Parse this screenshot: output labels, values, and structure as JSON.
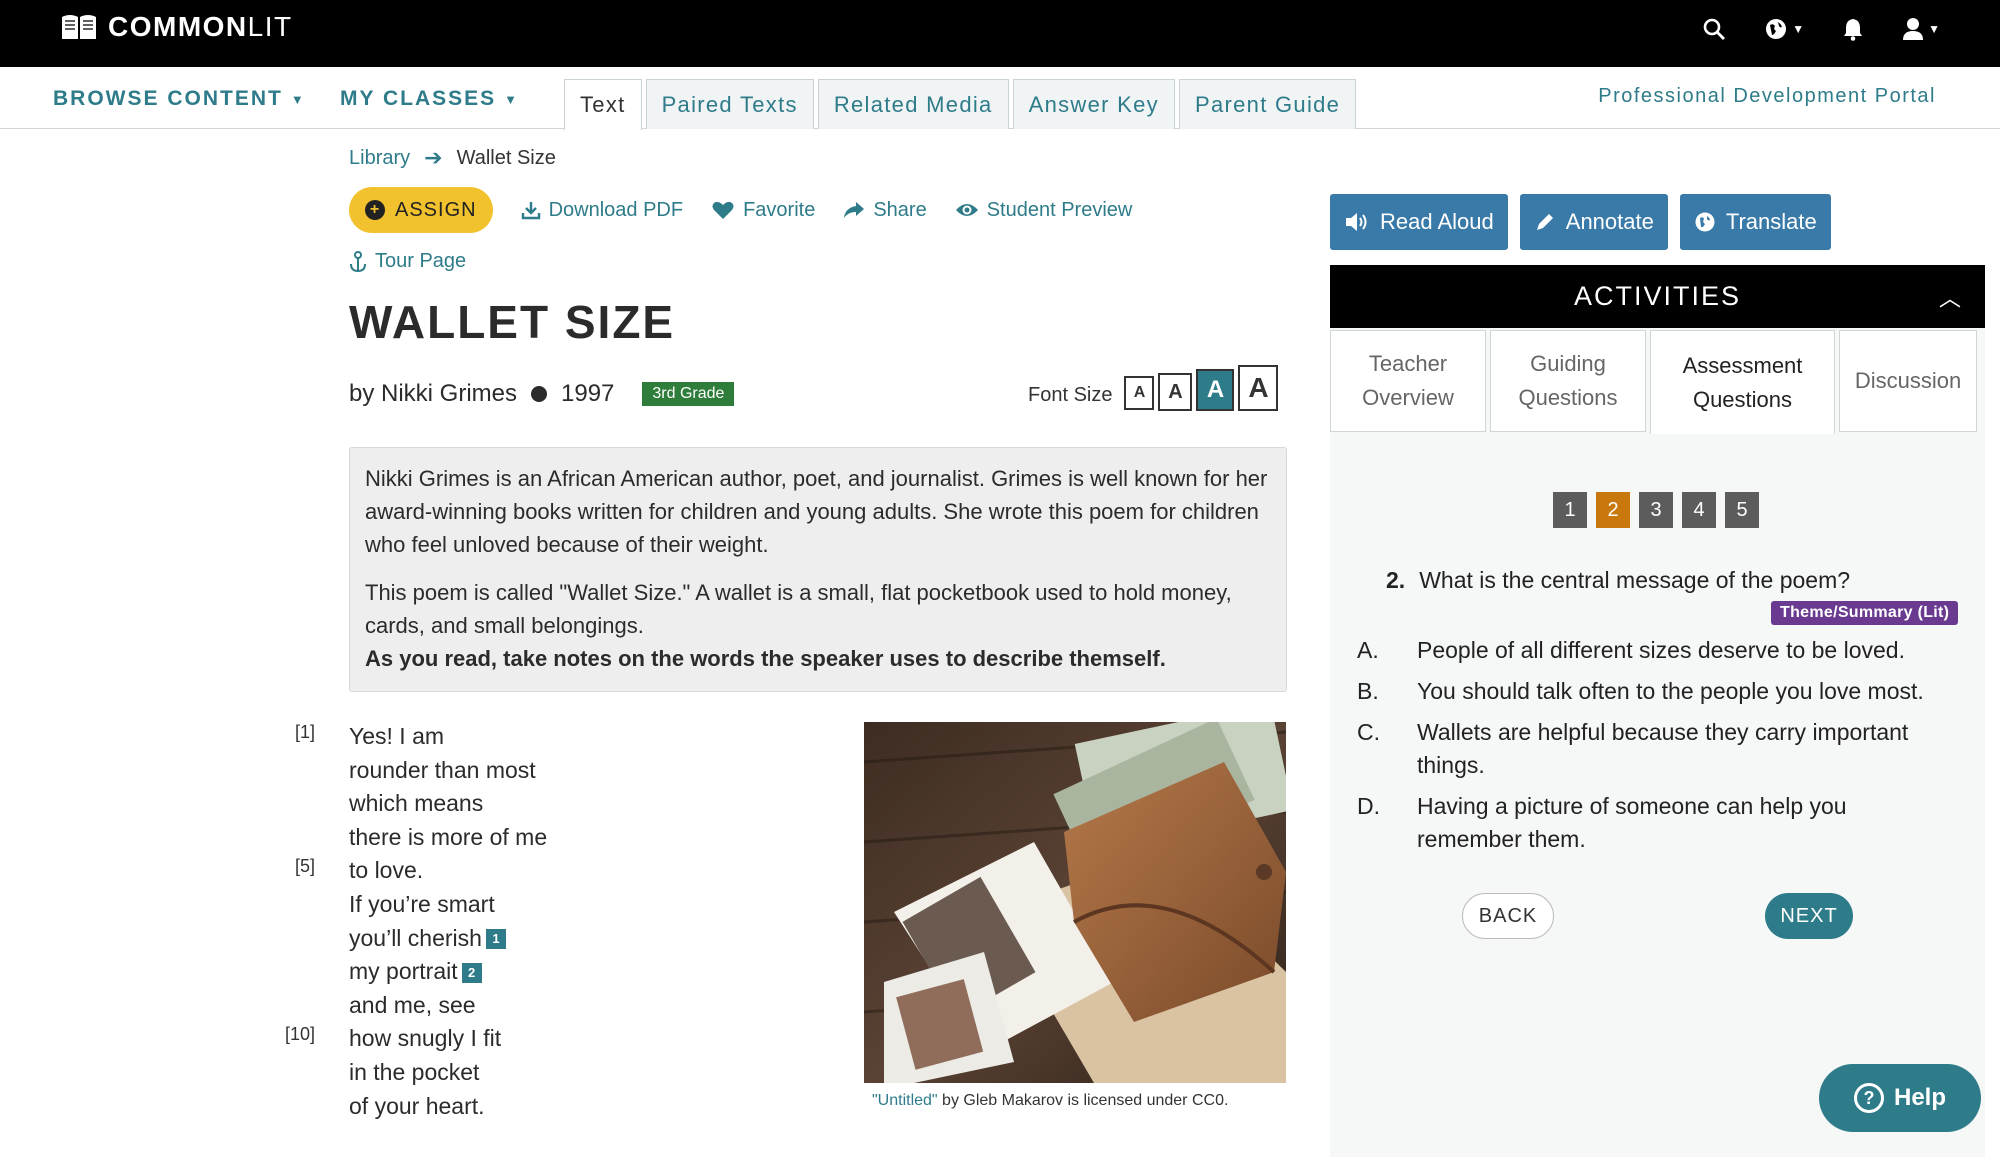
{
  "brand": {
    "name_bold": "COMMON",
    "name_light": "LIT"
  },
  "top_icons": [
    "search-icon",
    "globe-icon",
    "bell-icon",
    "user-icon"
  ],
  "nav": {
    "browse": "BROWSE CONTENT",
    "classes": "MY CLASSES",
    "tabs": [
      "Text",
      "Paired Texts",
      "Related Media",
      "Answer Key",
      "Parent Guide"
    ],
    "active_tab": "Text",
    "portal": "Professional Development Portal"
  },
  "breadcrumb": {
    "library": "Library",
    "current": "Wallet Size"
  },
  "actions": {
    "assign": "ASSIGN",
    "download": "Download PDF",
    "favorite": "Favorite",
    "share": "Share",
    "preview": "Student Preview",
    "tour": "Tour Page"
  },
  "text": {
    "title": "WALLET SIZE",
    "author": "by Nikki Grimes",
    "year": "1997",
    "grade": "3rd Grade",
    "font_size_label": "Font Size",
    "font_size_options": [
      "A",
      "A",
      "A",
      "A"
    ],
    "intro_p1": "Nikki Grimes is an African American author, poet, and journalist. Grimes is well known for her award-winning books written for children and young adults. She wrote this poem for children who feel unloved because of their weight.",
    "intro_p2": "This poem is called \"Wallet Size.\" A wallet is a small, flat pocketbook used to hold money, cards, and small belongings.",
    "intro_p3": "As you read, take notes on the words the speaker uses to describe themself."
  },
  "poem": {
    "lines": [
      {
        "num": "[1]",
        "text": "Yes! I am",
        "fn": ""
      },
      {
        "num": "",
        "text": "rounder than most",
        "fn": ""
      },
      {
        "num": "",
        "text": "which means",
        "fn": ""
      },
      {
        "num": "",
        "text": "there is more of me",
        "fn": ""
      },
      {
        "num": "[5]",
        "text": "to love.",
        "fn": ""
      },
      {
        "num": "",
        "text": "If you’re smart",
        "fn": ""
      },
      {
        "num": "",
        "text": "you’ll cherish",
        "fn": "1"
      },
      {
        "num": "",
        "text": "my portrait",
        "fn": "2"
      },
      {
        "num": "",
        "text": "and me, see",
        "fn": ""
      },
      {
        "num": "[10]",
        "text": "how snugly I fit",
        "fn": ""
      },
      {
        "num": "",
        "text": "in the pocket",
        "fn": ""
      },
      {
        "num": "",
        "text": "of your heart.",
        "fn": ""
      }
    ]
  },
  "image": {
    "caption_link": "\"Untitled\"",
    "caption_rest": " by Gleb Makarov is licensed under CC0."
  },
  "tools": {
    "read_aloud": "Read Aloud",
    "annotate": "Annotate",
    "translate": "Translate"
  },
  "activities": {
    "header": "ACTIVITIES",
    "tabs": [
      {
        "l1": "Teacher",
        "l2": "Overview"
      },
      {
        "l1": "Guiding",
        "l2": "Questions"
      },
      {
        "l1": "Assessment",
        "l2": "Questions"
      },
      {
        "l1": "Discussion",
        "l2": ""
      }
    ],
    "active_tab": 2,
    "question_numbers": [
      "1",
      "2",
      "3",
      "4",
      "5"
    ],
    "current_question": "2",
    "question": {
      "number": "2.",
      "text": "What is the central message of the poem?",
      "skill": "Theme/Summary (Lit)"
    },
    "options": [
      {
        "letter": "A.",
        "text": "People of all different sizes deserve to be loved."
      },
      {
        "letter": "B.",
        "text": "You should talk often to the people you love most."
      },
      {
        "letter": "C.",
        "text": "Wallets are helpful because they carry important things."
      },
      {
        "letter": "D.",
        "text": "Having a picture of someone can help you remember them."
      }
    ],
    "back": "BACK",
    "next": "NEXT"
  },
  "help": "Help",
  "colors": {
    "teal": "#2e7b8a",
    "assign_yellow": "#f2c12e",
    "tool_blue": "#3a7aa8",
    "current_q": "#c8780c",
    "skill_purple": "#6a3a91",
    "grade_green": "#2f7d3b"
  }
}
